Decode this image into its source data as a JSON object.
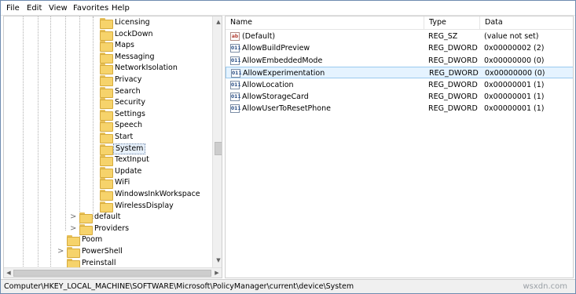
{
  "menu": [
    "File",
    "Edit",
    "View",
    "Favorites",
    "Help"
  ],
  "tree": {
    "children_of_current": [
      "Licensing",
      "LockDown",
      "Maps",
      "Messaging",
      "NetworkIsolation",
      "Privacy",
      "Search",
      "Security",
      "Settings",
      "Speech",
      "Start",
      "System",
      "TextInput",
      "Update",
      "WiFi",
      "WindowsInkWorkspace",
      "WirelessDisplay"
    ],
    "selected": "System",
    "siblings_level2": [
      "default",
      "Providers"
    ],
    "siblings_level1": [
      "Poom",
      "PowerShell",
      "Preinstall"
    ],
    "expander_collapsed": ">"
  },
  "list": {
    "columns": [
      "Name",
      "Type",
      "Data"
    ],
    "rows": [
      {
        "name": "(Default)",
        "type": "REG_SZ",
        "data": "(value not set)",
        "icon": "ab"
      },
      {
        "name": "AllowBuildPreview",
        "type": "REG_DWORD",
        "data": "0x00000002 (2)",
        "icon": "011"
      },
      {
        "name": "AllowEmbeddedMode",
        "type": "REG_DWORD",
        "data": "0x00000000 (0)",
        "icon": "011"
      },
      {
        "name": "AllowExperimentation",
        "type": "REG_DWORD",
        "data": "0x00000000 (0)",
        "icon": "011"
      },
      {
        "name": "AllowLocation",
        "type": "REG_DWORD",
        "data": "0x00000001 (1)",
        "icon": "011"
      },
      {
        "name": "AllowStorageCard",
        "type": "REG_DWORD",
        "data": "0x00000001 (1)",
        "icon": "011"
      },
      {
        "name": "AllowUserToResetPhone",
        "type": "REG_DWORD",
        "data": "0x00000001 (1)",
        "icon": "011"
      }
    ],
    "highlighted_row": 3
  },
  "status": {
    "path": "Computer\\HKEY_LOCAL_MACHINE\\SOFTWARE\\Microsoft\\PolicyManager\\current\\device\\System"
  },
  "watermark": "wsxdn.com",
  "scroll": {
    "up_arrow": "▲",
    "down_arrow": "▼",
    "left_arrow": "◀",
    "right_arrow": "▶"
  },
  "colors": {
    "selection_border": "#99c9ef",
    "selection_fill": "#e5f3ff",
    "folder": "#f6d36b"
  }
}
